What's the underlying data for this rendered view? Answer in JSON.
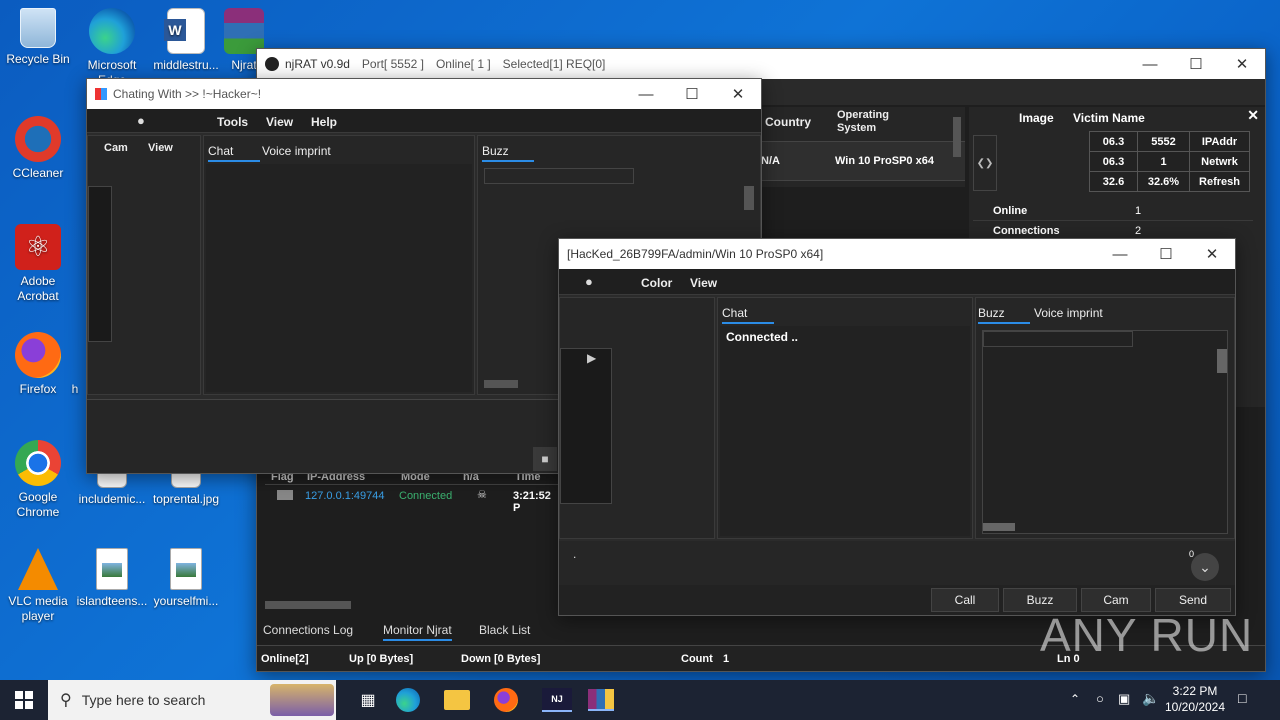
{
  "desktop": {
    "icons": [
      {
        "label": "Recycle Bin",
        "icon": "recycle-bin-icon"
      },
      {
        "label": "Microsoft Edge",
        "icon": "edge-icon"
      },
      {
        "label": "middlestru...",
        "icon": "word-doc-icon"
      },
      {
        "label": "Njrat",
        "icon": "winrar-icon"
      },
      {
        "label": "CCleaner",
        "icon": "ccleaner-icon"
      },
      {
        "label": "Adobe Acrobat",
        "icon": "acrobat-icon"
      },
      {
        "label": "Firefox",
        "icon": "firefox-icon"
      },
      {
        "label": "h",
        "icon": "file-icon"
      },
      {
        "label": "Google Chrome",
        "icon": "chrome-icon"
      },
      {
        "label": "includemic...",
        "icon": "image-file-icon"
      },
      {
        "label": "toprental.jpg",
        "icon": "image-file-icon"
      },
      {
        "label": "VLC media player",
        "icon": "vlc-icon"
      },
      {
        "label": "islandteens...",
        "icon": "image-file-icon"
      },
      {
        "label": "yourselfmi...",
        "icon": "image-file-icon"
      }
    ]
  },
  "njrat": {
    "title": "njRAT v0.9d",
    "port": "Port[ 5552 ]",
    "online": "Online[ 1 ]",
    "selected": "Selected[1] REQ[0]",
    "table_headers": {
      "country": "Country",
      "os": "Operating System"
    },
    "row": {
      "country": "N/A",
      "os": "Win 10 ProSP0 x64"
    },
    "info_headers": {
      "image": "Image",
      "victim": "Victim Name"
    },
    "stats": [
      [
        "06.3",
        "5552",
        "IPAddr"
      ],
      [
        "06.3",
        "1",
        "Netwrk"
      ],
      [
        "32.6",
        "32.6%",
        "Refresh"
      ]
    ],
    "info_rows": [
      {
        "k": "Online",
        "v": "1"
      },
      {
        "k": "Connections",
        "v": "2"
      }
    ],
    "log_headers": {
      "flag": "Flag",
      "ip": "IP-Address",
      "mode": "Mode",
      "na": "n/a",
      "time": "Time"
    },
    "log_row": {
      "ip": "127.0.0.1:49744",
      "mode": "Connected",
      "time": "3:21:52 P"
    },
    "bottom_tabs": {
      "conn_log": "Connections Log",
      "monitor": "Monitor Njrat",
      "black": "Black List"
    },
    "status": {
      "online": "Online[2]",
      "up": "Up [0 Bytes]",
      "down": "Down [0 Bytes]",
      "count_label": "Count",
      "count": "1",
      "ln": "Ln 0"
    }
  },
  "chat1": {
    "title": "Chating With >> !~Hacker~!",
    "menu": {
      "tools": "Tools",
      "view": "View",
      "help": "Help"
    },
    "side_menu": {
      "cam": "Cam",
      "view": "View"
    },
    "tabs": {
      "chat": "Chat",
      "voice": "Voice imprint",
      "buzz": "Buzz"
    }
  },
  "chat2": {
    "title": "[HacKed_26B799FA/admin/Win 10 ProSP0 x64]",
    "menu": {
      "color": "Color",
      "view": "View"
    },
    "tabs": {
      "chat": "Chat",
      "buzz": "Buzz",
      "voice": "Voice imprint"
    },
    "message": "Connected ..",
    "input_text": ".",
    "badge": "0",
    "buttons": {
      "call": "Call",
      "buzz": "Buzz",
      "cam": "Cam",
      "send": "Send"
    }
  },
  "watermark": "ANY RUN",
  "taskbar": {
    "search_placeholder": "Type here to search",
    "time": "3:22 PM",
    "date": "10/20/2024"
  }
}
